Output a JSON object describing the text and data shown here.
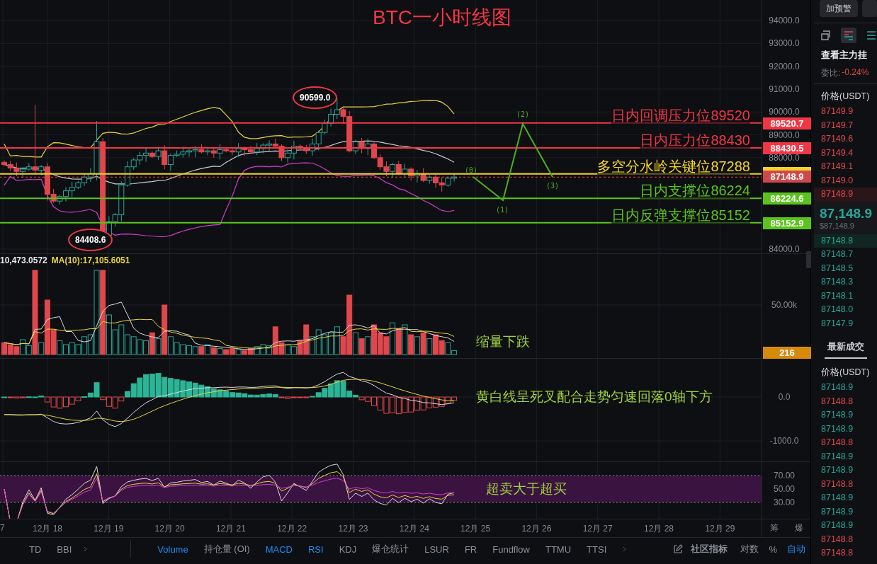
{
  "title": "BTC一小时线图",
  "price_axis": {
    "ticks": [
      "94000.0",
      "93000.0",
      "92000.0",
      "91000.0",
      "90000.0",
      "89000.0",
      "88000.0",
      "84000.0"
    ]
  },
  "levels": [
    {
      "annotation": "日内回调压力位89520",
      "tag": "89520.7",
      "color": "#f23645"
    },
    {
      "annotation": "日内压力位88430",
      "tag": "88430.5",
      "color": "#f23645"
    },
    {
      "annotation": "多空分水岭关键位87288",
      "color": "#f5d327"
    },
    {
      "annotation": "日内支撑位86224",
      "tag": "86224.6",
      "color": "#5ac41c"
    },
    {
      "annotation": "日内反弹支撑位85152",
      "tag": "85152.9",
      "color": "#5ac41c"
    }
  ],
  "current_price_tag": "87148.9",
  "markers": [
    {
      "kind": "high",
      "label": "90599.0"
    },
    {
      "kind": "low",
      "label": "84408.6"
    }
  ],
  "projection_labels": [
    "(0)",
    "(1)",
    "(2)",
    "(3)"
  ],
  "volume_panel": {
    "value": "10,473.0572",
    "ma": "MA(10):17,105.6051",
    "axis_ticks": [
      "50.00k"
    ],
    "tag": "216",
    "annotation": "缩量下跌"
  },
  "macd_panel": {
    "axis_ticks": [
      "0.0",
      "-1000.0"
    ],
    "annotation": "黄白线呈死叉配合走势匀速回落0轴下方"
  },
  "rsi_panel": {
    "axis_ticks": [
      "70.00",
      "50.00",
      "30.00"
    ],
    "annotation": "超卖大于超买"
  },
  "date_axis": {
    "labels": [
      "7",
      "12月 18",
      "12月 19",
      "12月 20",
      "12月 21",
      "12月 22",
      "12月 23",
      "12月 24",
      "12月 25",
      "12月 26",
      "12月 27",
      "12月 28",
      "12月 29"
    ],
    "extra": [
      "筹",
      "爆"
    ]
  },
  "indicator_bar": {
    "left": [
      "TD",
      "BBI"
    ],
    "items": [
      {
        "label": "Volume",
        "selected": true
      },
      {
        "label": "持仓量 (OI)",
        "selected": false
      },
      {
        "label": "MACD",
        "selected": true
      },
      {
        "label": "RSI",
        "selected": true
      },
      {
        "label": "KDJ",
        "selected": false
      },
      {
        "label": "爆仓统计",
        "selected": false
      },
      {
        "label": "LSUR",
        "selected": false
      },
      {
        "label": "FR",
        "selected": false
      },
      {
        "label": "Fundflow",
        "selected": false
      },
      {
        "label": "TTMU",
        "selected": false
      },
      {
        "label": "TTSI",
        "selected": false
      }
    ],
    "community": "社区指标",
    "options": [
      {
        "label": "对数",
        "selected": false
      },
      {
        "label": "%",
        "selected": false
      },
      {
        "label": "自动",
        "selected": true
      }
    ]
  },
  "sidebar": {
    "alert_button": "加预警",
    "view_modes": [
      {
        "kind": "plain",
        "selected": false
      },
      {
        "kind": "both",
        "selected": true
      },
      {
        "kind": "list",
        "selected": false
      }
    ],
    "orders_link": "查看主力挂",
    "ratio_label": "委比:",
    "ratio_value": "-0.24%",
    "price_header": "价格(USDT)",
    "asks": [
      "87149.9",
      "87149.7",
      "87149.6",
      "87149.4",
      "87149.1",
      "87149.0",
      "87148.9"
    ],
    "last_price": "87,148.9",
    "last_price_usd": "$87,148.9",
    "bids": [
      "87148.8",
      "87148.7",
      "87148.5",
      "87148.3",
      "87148.1",
      "87148.0",
      "87147.9"
    ],
    "trades_tab": "最新成交",
    "trades_header": "价格(USDT)",
    "trades": [
      {
        "price": "87148.9",
        "kind": "buy"
      },
      {
        "price": "87148.8",
        "kind": "sell"
      },
      {
        "price": "87148.9",
        "kind": "buy"
      },
      {
        "price": "87148.9",
        "kind": "buy"
      },
      {
        "price": "87148.8",
        "kind": "sell"
      },
      {
        "price": "87148.9",
        "kind": "buy"
      },
      {
        "price": "87148.9",
        "kind": "buy"
      },
      {
        "price": "87148.8",
        "kind": "sell"
      },
      {
        "price": "87148.9",
        "kind": "buy"
      },
      {
        "price": "87148.9",
        "kind": "buy"
      },
      {
        "price": "87148.9",
        "kind": "buy"
      },
      {
        "price": "87148.8",
        "kind": "sell"
      },
      {
        "price": "87148.8",
        "kind": "sell"
      }
    ]
  }
}
